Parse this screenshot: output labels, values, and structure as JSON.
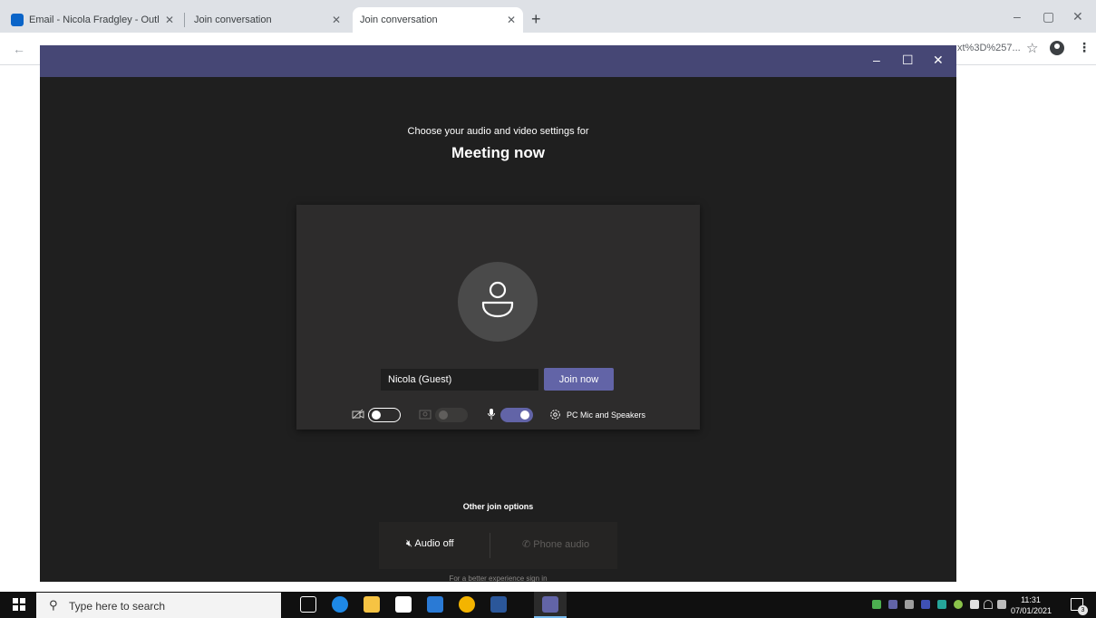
{
  "browser": {
    "tabs": [
      {
        "title": "Email - Nicola Fradgley - Outlook",
        "favicon": "outlook-icon",
        "active": false
      },
      {
        "title": "Join conversation",
        "favicon": "teams-icon",
        "active": false
      },
      {
        "title": "Join conversation",
        "favicon": "teams-icon",
        "active": true
      }
    ],
    "new_tab_label": "+",
    "address_tail": "xt%3D%257...",
    "window_controls": {
      "minimize": "–",
      "maximize": "▢",
      "close": "✕"
    }
  },
  "teams_window": {
    "controls": {
      "minimize": "–",
      "maximize": "☐",
      "close": "✕"
    },
    "prejoin": {
      "subtitle": "Choose your audio and video settings for",
      "meeting_title": "Meeting now",
      "name_value": "Nicola (Guest)",
      "join_button_label": "Join now",
      "camera_toggle": "off",
      "blur_toggle": "disabled",
      "mic_toggle": "on",
      "device_label": "PC Mic and Speakers"
    },
    "other_join_options": {
      "title": "Other join options",
      "audio_off_label": "Audio off",
      "phone_audio_label": "Phone audio",
      "signin_hint": "For a better experience sign in"
    }
  },
  "taskbar": {
    "search_placeholder": "Type here to search",
    "time": "11:31",
    "date": "07/01/2021",
    "notification_count": "3"
  },
  "colors": {
    "teams_accent": "#6264a7",
    "teams_titlebar": "#464775",
    "teams_background": "#1f1f1f"
  }
}
